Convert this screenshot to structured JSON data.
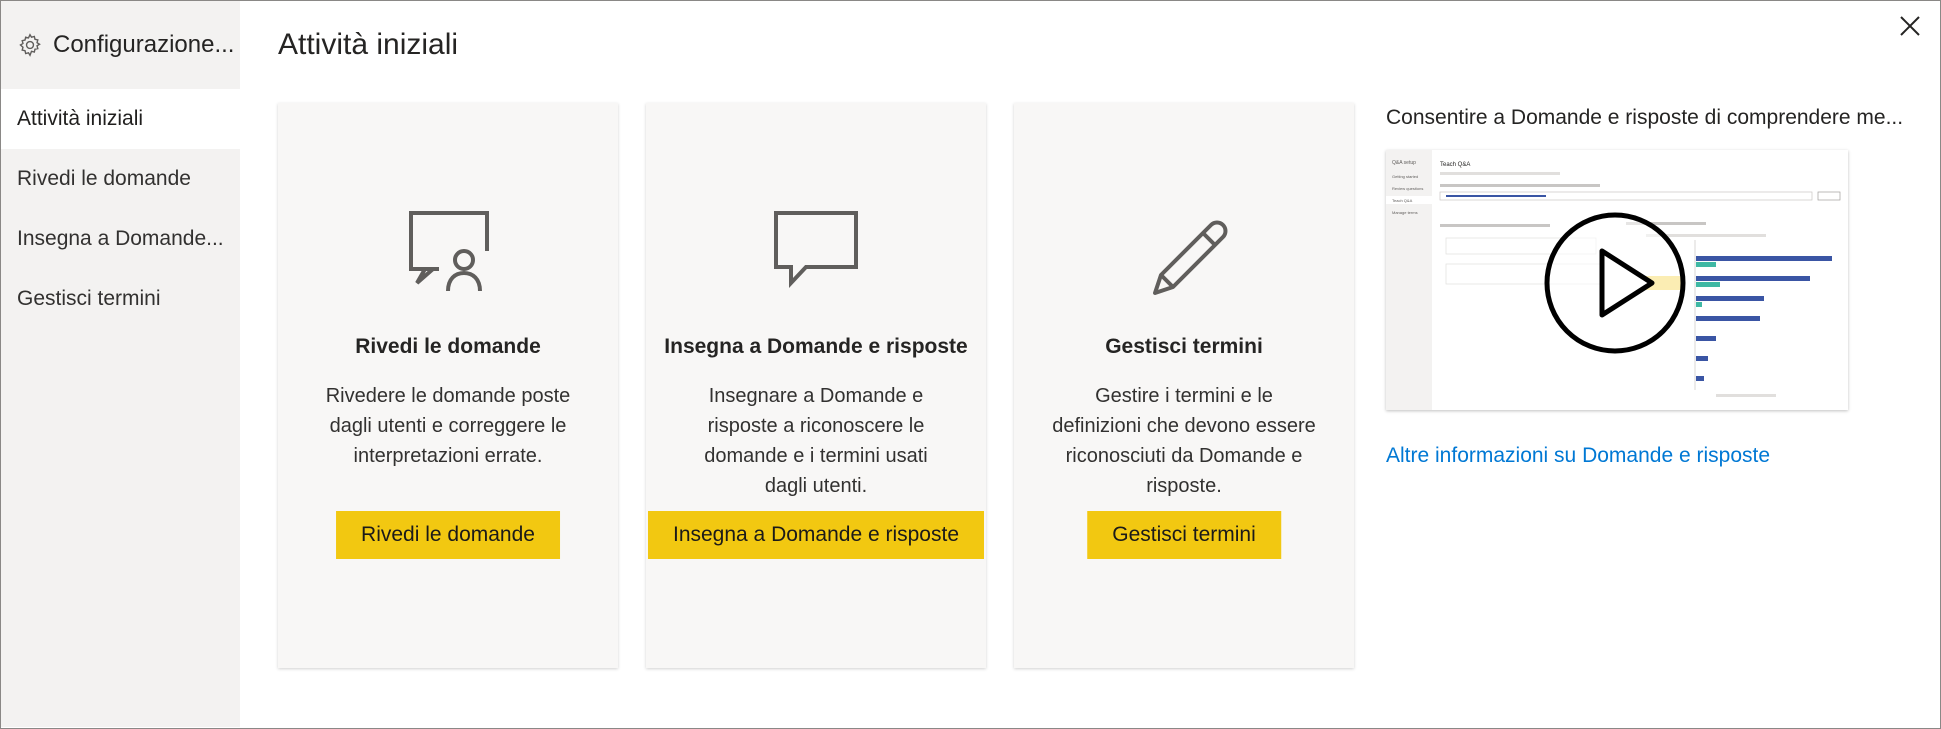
{
  "app": {
    "title": "Configurazione...",
    "close_label": "Chiudi"
  },
  "sidebar": {
    "items": [
      {
        "label": "Attività iniziali",
        "active": true
      },
      {
        "label": "Rivedi le domande",
        "active": false
      },
      {
        "label": "Insegna a Domande...",
        "active": false
      },
      {
        "label": "Gestisci termini",
        "active": false
      }
    ]
  },
  "main": {
    "title": "Attività iniziali",
    "cards": [
      {
        "icon": "review-questions-icon",
        "title": "Rivedi le domande",
        "description": "Rivedere le domande poste dagli utenti e correggere le interpretazioni errate.",
        "button": "Rivedi le domande"
      },
      {
        "icon": "speech-bubble-icon",
        "title": "Insegna a Domande e risposte",
        "description": "Insegnare a Domande e risposte a riconoscere le domande e i termini usati dagli utenti.",
        "button": "Insegna a Domande e risposte"
      },
      {
        "icon": "pencil-icon",
        "title": "Gestisci termini",
        "description": "Gestire i termini e le definizioni che devono essere riconosciuti da Domande e risposte.",
        "button": "Gestisci termini"
      }
    ],
    "video": {
      "title": "Consentire a Domande e risposte di comprendere me...",
      "thumbnail": {
        "window_title": "Teach Q&A",
        "sidebar_items": [
          "Q&A setup",
          "Getting started",
          "Review questions",
          "Teach Q&A",
          "Manage terms"
        ],
        "play_icon": "play-icon"
      }
    },
    "learn_more_link": "Altre informazioni su Domande e risposte"
  },
  "colors": {
    "accent_button": "#f2c811",
    "link": "#0078d4",
    "sidebar_bg": "#f3f2f1",
    "card_bg": "#f8f7f6",
    "chart_blue": "#3a55a4",
    "chart_teal": "#3fb8a4"
  }
}
